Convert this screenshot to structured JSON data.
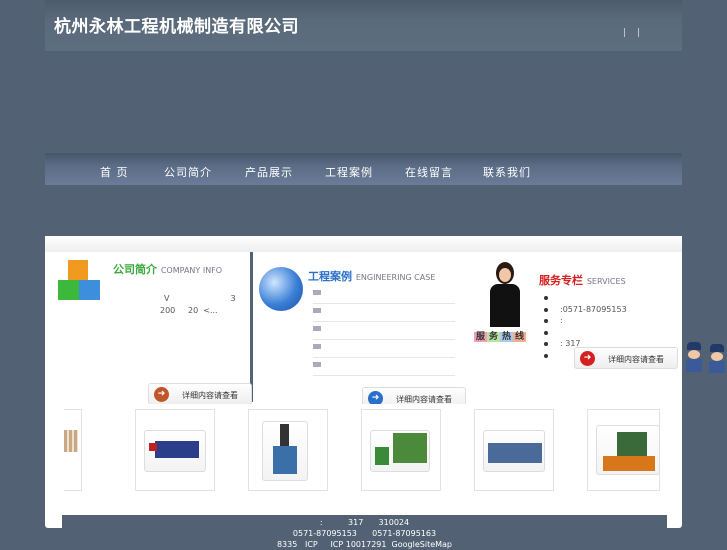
{
  "header": {
    "title": "杭州永林工程机械制造有限公司",
    "links": "| |"
  },
  "nav": [
    "首 页",
    "公司简介",
    "产品展示",
    "工程案例",
    "在线留言",
    "联系我们"
  ],
  "company": {
    "title": "公司简介",
    "subtitle": "COMPANY INFO",
    "line1": "V                        3",
    "line2": "200     20  <...",
    "more": "详细内容请查看"
  },
  "cases": {
    "title": "工程案例",
    "subtitle": "ENGINEERING CASE",
    "items": [
      "",
      "",
      "",
      "",
      ""
    ],
    "more": "详细内容请查看"
  },
  "services": {
    "title": "服务专栏",
    "subtitle": "SERVICES",
    "badge": [
      "服",
      "务",
      "热",
      "线"
    ],
    "items": [
      "",
      ":0571-87095153",
      ":",
      "",
      ":          317",
      ""
    ],
    "more": "详细内容请查看"
  },
  "products": [
    "pipe",
    "bending-machine",
    "cutting-machine",
    "shearing-machine",
    "sawing-machine",
    "winding-machine"
  ],
  "footer": {
    "line1": ":          317      310024",
    "line2": "0571-87095153      0571-87095163",
    "line3": "8335   ICP     ICP 10017291  GoogleSiteMap"
  },
  "colors": {
    "background": "#526173",
    "company_title": "#3aa83a",
    "cases_title": "#2a6fc9",
    "services_title": "#d42020"
  }
}
